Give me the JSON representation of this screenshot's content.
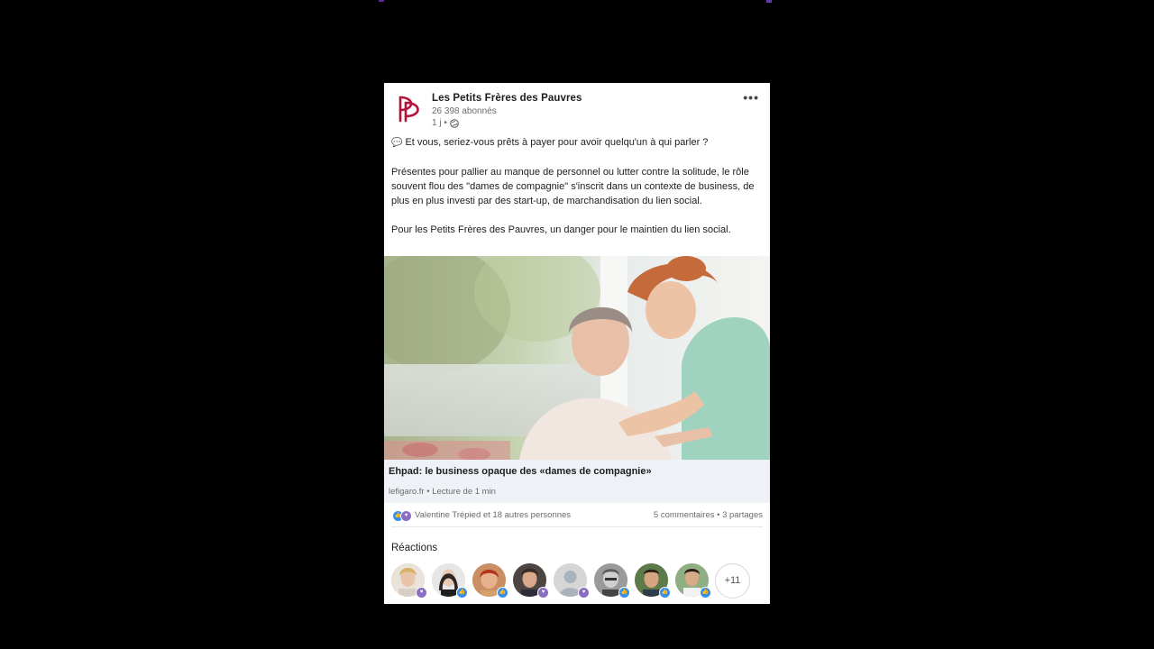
{
  "post": {
    "org_name": "Les Petits Frères des Pauvres",
    "followers": "26 398 abonnés",
    "time": "1 j •",
    "more_label": "•••",
    "text": {
      "p1": "Et vous, seriez-vous prêts à payer pour avoir quelqu'un à qui parler ?",
      "p2": "Présentes pour pallier au manque de personnel ou lutter contre la solitude, le rôle souvent flou des \"dames de compagnie\" s'inscrit dans un contexte de business, de plus en plus investi par des start-up, de marchandisation du lien social.",
      "p3": "Pour les Petits Frères des Pauvres, un danger pour le maintien du lien social."
    },
    "link": {
      "title": "Ehpad: le business opaque des «dames de compagnie»",
      "source": "lefigaro.fr • Lecture de 1 min"
    },
    "social": {
      "reactions_text": "Valentine Trépied et 18 autres personnes",
      "counts": "5 commentaires • 3 partages"
    },
    "reactions_title": "Réactions",
    "more_reactors": "+11",
    "colors": {
      "brand": "#b5123a",
      "like": "#378fe9",
      "love": "#8a6ec2"
    }
  }
}
